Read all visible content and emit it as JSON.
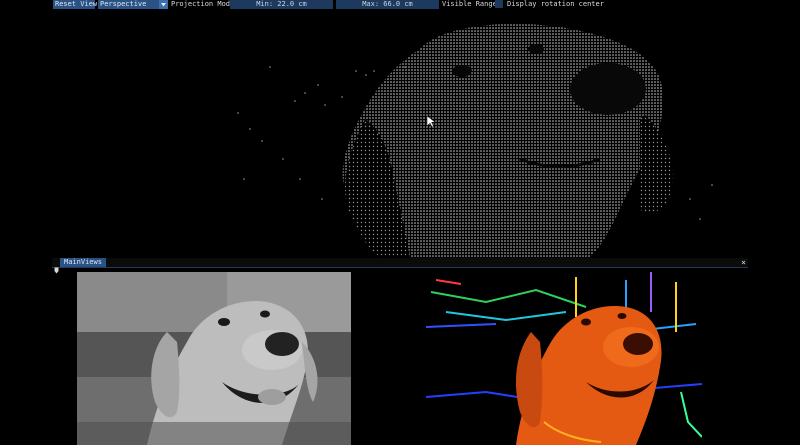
{
  "toolbar": {
    "reset_label": "Reset View",
    "projection_value": "Perspective",
    "projection_label": "Projection Mode",
    "min_value": "Min: 22.0 cm",
    "max_value": "Max: 66.0 cm",
    "range_label": "Visible Range",
    "rotation_label": "Display rotation center"
  },
  "panel": {
    "tab_label": "MainViews",
    "close_glyph": "×"
  },
  "icons": {
    "dropdown": "triangle-down-icon",
    "panel": "pin-icon",
    "close": "close-icon",
    "cursor": "mouse-cursor-icon"
  },
  "colors": {
    "widget": "#2a5285",
    "widget_dark": "#1d3a5e",
    "background": "#000000"
  }
}
